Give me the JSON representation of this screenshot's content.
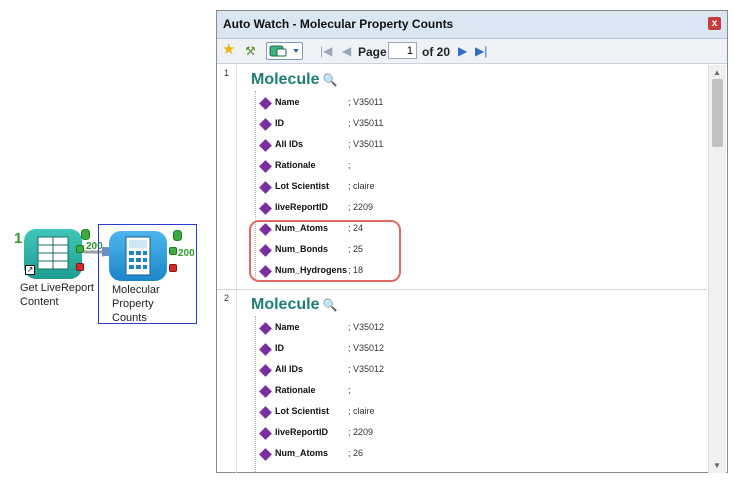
{
  "pipeline": {
    "source_node": {
      "count": "1",
      "label": "Get LiveReport\nContent",
      "port_count": "200"
    },
    "target_node": {
      "label": "Molecular\nProperty\nCounts",
      "port_count": "200"
    }
  },
  "window": {
    "title": "Auto Watch - Molecular Property Counts",
    "close_glyph": "x",
    "toolbar": {
      "page_label": "Page",
      "page_value": "1",
      "of_label": "of 20"
    },
    "records": [
      {
        "index": "1",
        "title": "Molecule",
        "props": [
          {
            "name": "Name",
            "value": "V35011"
          },
          {
            "name": "ID",
            "value": "V35011"
          },
          {
            "name": "All IDs",
            "value": "V35011"
          },
          {
            "name": "Rationale",
            "value": ""
          },
          {
            "name": "Lot Scientist",
            "value": "claire"
          },
          {
            "name": "liveReportID",
            "value": "2209"
          },
          {
            "name": "Num_Atoms",
            "value": "24"
          },
          {
            "name": "Num_Bonds",
            "value": "25"
          },
          {
            "name": "Num_Hydrogens",
            "value": "18"
          }
        ]
      },
      {
        "index": "2",
        "title": "Molecule",
        "props": [
          {
            "name": "Name",
            "value": "V35012"
          },
          {
            "name": "ID",
            "value": "V35012"
          },
          {
            "name": "All IDs",
            "value": "V35012"
          },
          {
            "name": "Rationale",
            "value": ""
          },
          {
            "name": "Lot Scientist",
            "value": "claire"
          },
          {
            "name": "liveReportID",
            "value": "2209"
          },
          {
            "name": "Num_Atoms",
            "value": "26"
          }
        ]
      }
    ]
  },
  "colors": {
    "title_teal": "#1f7e73",
    "diamond_purple": "#7a2ea0",
    "highlight_red": "#e06a63",
    "port_count_green": "#2e9b2e"
  },
  "icons": {
    "favorite": "star-icon",
    "tool": "magic-wand-icon",
    "view": "view-toggle-icon",
    "search": "magnifier-icon",
    "property": "diamond-icon"
  }
}
